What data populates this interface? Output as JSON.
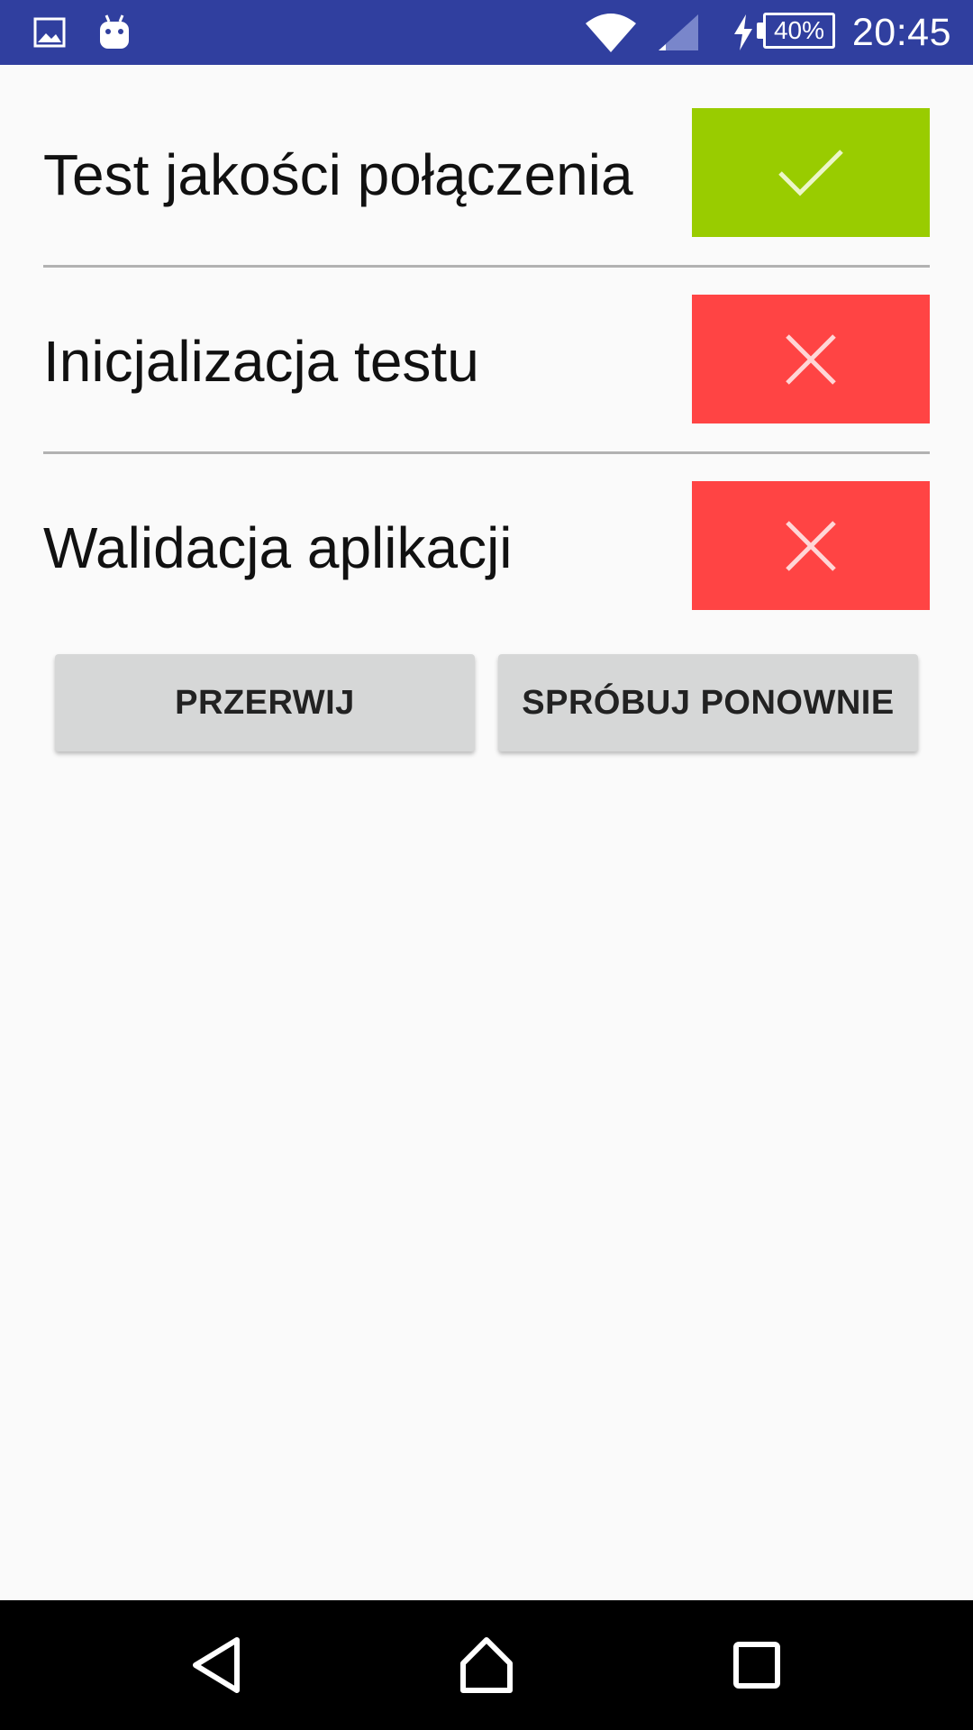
{
  "status_bar": {
    "time": "20:45",
    "battery": "40%",
    "icons": [
      "image-icon",
      "android-icon",
      "wifi-icon",
      "signal-icon",
      "charging-icon",
      "battery-icon"
    ]
  },
  "checks": [
    {
      "label": "Test jakości połączenia",
      "status": "success",
      "icon": "check-icon",
      "color": "#99cc00"
    },
    {
      "label": "Inicjalizacja testu",
      "status": "failure",
      "icon": "close-icon",
      "color": "#ff4444"
    },
    {
      "label": "Walidacja aplikacji",
      "status": "failure",
      "icon": "close-icon",
      "color": "#ff4444"
    }
  ],
  "buttons": {
    "abort_label": "PRZERWIJ",
    "retry_label": "SPRÓBUJ PONOWNIE"
  },
  "nav_bar": {
    "icons": [
      "back-icon",
      "home-icon",
      "recents-icon"
    ]
  }
}
